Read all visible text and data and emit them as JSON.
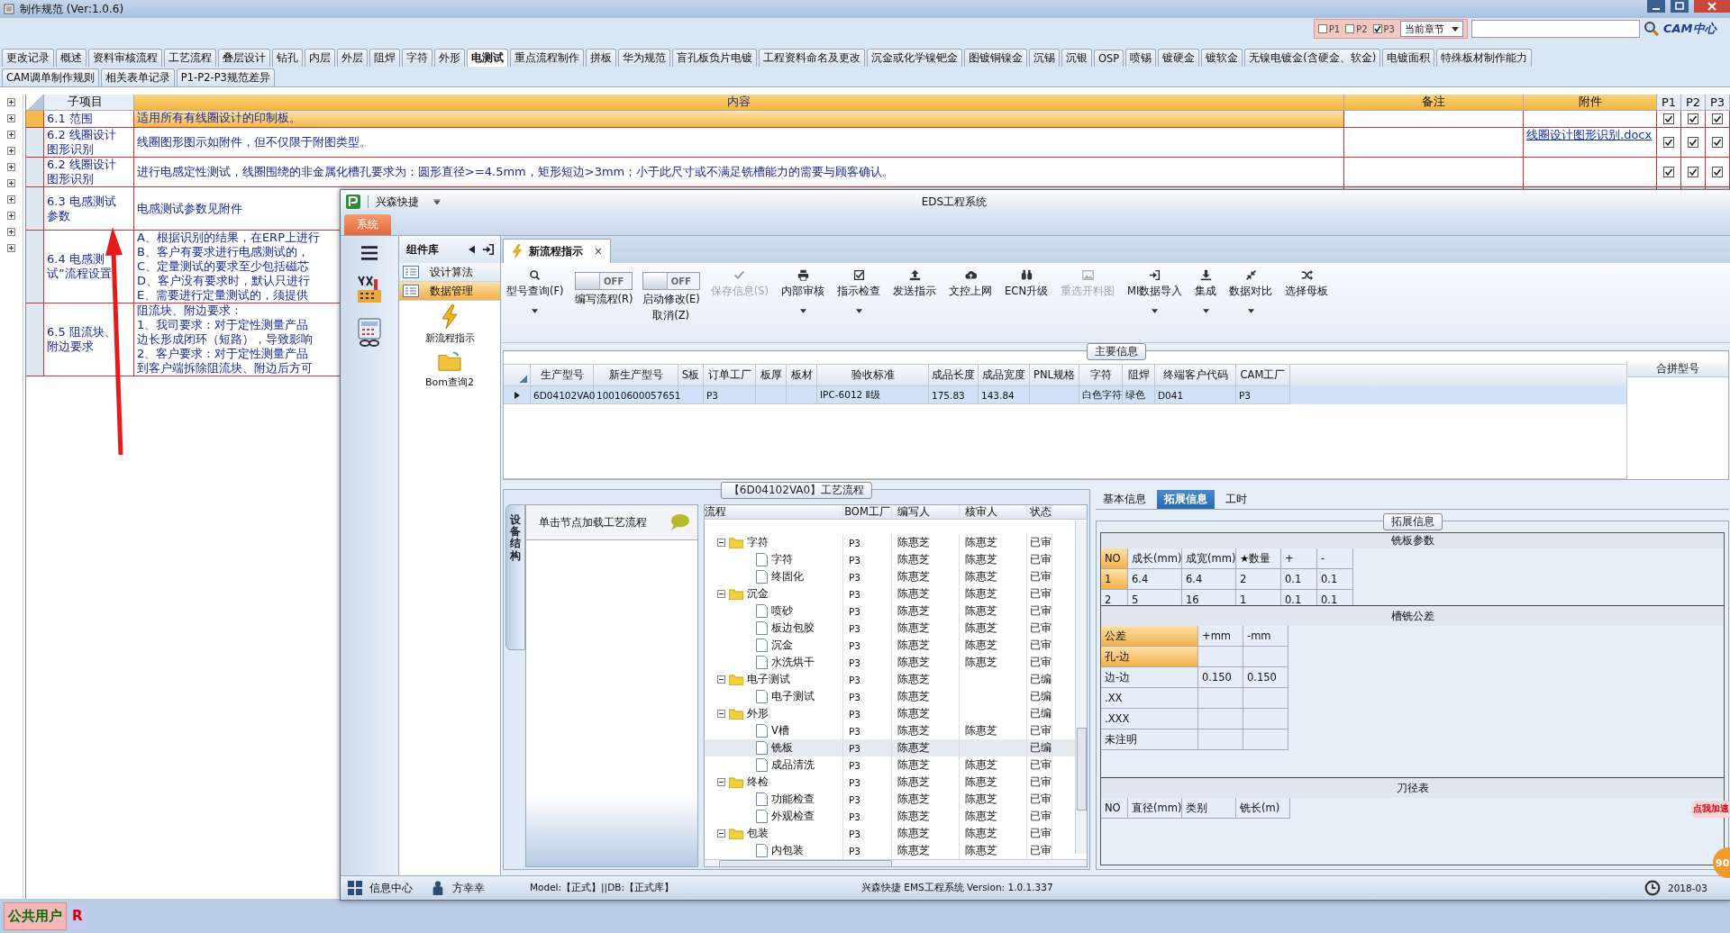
{
  "app": {
    "title": "制作规范 (Ver:1.0.6)"
  },
  "filter": {
    "checks": [
      {
        "label": "P1",
        "checked": false
      },
      {
        "label": "P2",
        "checked": false
      },
      {
        "label": "P3",
        "checked": true
      }
    ],
    "scope": "当前章节",
    "logo": "CAM中心"
  },
  "tabs_row1": [
    {
      "label": "更改记录",
      "selected": false
    },
    {
      "label": "概述",
      "selected": false
    },
    {
      "label": "资料审核流程",
      "selected": false
    },
    {
      "label": "工艺流程",
      "selected": false
    },
    {
      "label": "叠层设计",
      "selected": false
    },
    {
      "label": "钻孔",
      "selected": false
    },
    {
      "label": "内层",
      "selected": false
    },
    {
      "label": "外层",
      "selected": false
    },
    {
      "label": "阻焊",
      "selected": false
    },
    {
      "label": "字符",
      "selected": false
    },
    {
      "label": "外形",
      "selected": false
    },
    {
      "label": "电测试",
      "selected": true
    },
    {
      "label": "重点流程制作",
      "selected": false
    },
    {
      "label": "拼板",
      "selected": false
    },
    {
      "label": "华为规范",
      "selected": false
    },
    {
      "label": "盲孔板负片电镀",
      "selected": false
    },
    {
      "label": "工程资料命名及更改",
      "selected": false
    },
    {
      "label": "沉金或化学镍钯金",
      "selected": false
    },
    {
      "label": "图镀铜镍金",
      "selected": false
    },
    {
      "label": "沉锡",
      "selected": false
    },
    {
      "label": "沉银",
      "selected": false
    },
    {
      "label": "OSP",
      "selected": false
    },
    {
      "label": "喷锡",
      "selected": false
    },
    {
      "label": "镀硬金",
      "selected": false
    },
    {
      "label": "镀软金",
      "selected": false
    },
    {
      "label": "无镍电镀金(含硬金、软金)",
      "selected": false
    },
    {
      "label": "电镀面积",
      "selected": false
    },
    {
      "label": "特殊板材制作能力",
      "selected": false
    }
  ],
  "tabs_row2": [
    {
      "label": "CAM调单制作规则",
      "selected": false
    },
    {
      "label": "相关表单记录",
      "selected": false
    },
    {
      "label": "P1-P2-P3规范差异",
      "selected": false
    }
  ],
  "table": {
    "columns": [
      "子项目",
      "内容",
      "备注",
      "附件",
      "P1",
      "P2",
      "P3"
    ],
    "rows": [
      {
        "item": "6.1 范围",
        "content": [
          "适用所有有线圈设计的印制板。"
        ],
        "checks": [
          true,
          true,
          true
        ],
        "selected": true
      },
      {
        "item": "6.2 线圈设计图形识别",
        "content": [
          "线圈图形图示如附件，但不仅限于附图类型。"
        ],
        "attachment": "线圈设计图形识别.docx",
        "checks": [
          true,
          true,
          true
        ],
        "selected": false
      },
      {
        "item": "6.2 线圈设计图形识别",
        "content": [
          "进行电感定性测试，线圈围绕的非金属化槽孔要求为：圆形直径>=4.5mm，矩形短边>3mm；小于此尺寸或不满足铣槽能力的需要与顾客确认。"
        ],
        "checks": [
          true,
          true,
          true
        ],
        "selected": false
      },
      {
        "item": "6.3 电感测试参数",
        "content": [
          "电感测试参数见附件"
        ],
        "selected": false
      },
      {
        "item": "6.4 电感测试”流程设置",
        "content": [
          "A、根据识别的结果，在ERP上进行",
          "B、客户有要求进行电感测试的，",
          "C、定量测试的要求至少包括磁芯",
          "D、客户没有要求时，默认只进行",
          "E、需要进行定量测试的，须提供"
        ],
        "selected": false
      },
      {
        "item": "6.5 阻流块、附边要求",
        "content": [
          "阻流块、附边要求：",
          "1、我司要求：对于定性测量产品",
          "边长形成闭环（短路），导致影响",
          "2、客户要求：对于定性测量产品",
          "到客户端拆除阻流块、附边后方可"
        ],
        "selected": false
      }
    ]
  },
  "footer": {
    "user": "公共用户",
    "mark": "R"
  },
  "eds": {
    "brand": "兴森快捷",
    "title": "EDS工程系统",
    "menu_tab": "系统",
    "components": {
      "title": "组件库",
      "items": [
        {
          "label": "设计算法",
          "selected": false
        },
        {
          "label": "数据管理",
          "selected": true
        }
      ],
      "tools": [
        {
          "label": "新流程指示",
          "kind": "lightning"
        },
        {
          "label": "Bom查询2",
          "kind": "folder"
        }
      ]
    },
    "doc_tab": {
      "label": "新流程指示",
      "close": "×"
    },
    "toolbar": [
      {
        "kind": "button",
        "label": "型号查询(F)",
        "dropdown": true,
        "disabled": false
      },
      {
        "kind": "toggle",
        "label": "编写流程(R)",
        "state": "OFF",
        "on": false
      },
      {
        "kind": "toggle",
        "label": "启动修改(E)",
        "sub": "取消(Z)",
        "state": "OFF",
        "on": false
      },
      {
        "kind": "button",
        "label": "保存信息(S)",
        "dropdown": false,
        "disabled": true
      },
      {
        "kind": "button",
        "label": "内部审核",
        "dropdown": true,
        "disabled": false
      },
      {
        "kind": "button",
        "label": "指示检查",
        "dropdown": true,
        "disabled": false
      },
      {
        "kind": "button",
        "label": "发送指示",
        "dropdown": false,
        "disabled": false
      },
      {
        "kind": "button",
        "label": "文控上网",
        "dropdown": false,
        "disabled": false
      },
      {
        "kind": "button",
        "label": "ECN升级",
        "dropdown": false,
        "disabled": false
      },
      {
        "kind": "button",
        "label": "重选开料图",
        "dropdown": false,
        "disabled": true
      },
      {
        "kind": "button",
        "label": "MI数据导入",
        "dropdown": true,
        "disabled": false
      },
      {
        "kind": "button",
        "label": "集成",
        "dropdown": true,
        "disabled": false
      },
      {
        "kind": "button",
        "label": "数据对比",
        "dropdown": true,
        "disabled": false
      },
      {
        "kind": "button",
        "label": "选择母板",
        "dropdown": false,
        "disabled": false
      }
    ],
    "main_info": {
      "title": "主要信息",
      "columns": [
        "生产型号",
        "新生产型号",
        "S板",
        "订单工厂",
        "板厚",
        "板材",
        "验收标准",
        "成品长度",
        "成品宽度",
        "PNL规格",
        "字符",
        "阻焊",
        "终端客户代码",
        "CAM工厂"
      ],
      "rows": [
        {
          "cells": [
            "6D04102VA0",
            "10010600057651",
            "",
            "P3",
            "",
            "",
            "IPC-6012 Ⅱ级",
            "175.83",
            "143.84",
            "",
            "白色字符",
            "绿色",
            "D041",
            "P3"
          ],
          "selected": true
        }
      ],
      "side_column": "合拼型号"
    },
    "flow": {
      "title": "【6D04102VA0】工艺流程",
      "side_tab": "设备结构",
      "hint": "单击节点加载工艺流程",
      "columns": [
        "流程",
        "BOM工厂",
        "编写人",
        "核审人",
        "状态"
      ],
      "nodes": [
        {
          "name": "字符",
          "factory": "P3",
          "writer": "陈惠芝",
          "reviewer": "陈惠芝",
          "status": "已审",
          "expanded": true,
          "selected": false,
          "children": [
            {
              "name": "字符",
              "factory": "P3",
              "writer": "陈惠芝",
              "reviewer": "陈惠芝",
              "status": "已审",
              "selected": false
            },
            {
              "name": "终固化",
              "factory": "P3",
              "writer": "陈惠芝",
              "reviewer": "陈惠芝",
              "status": "已审",
              "selected": false
            }
          ]
        },
        {
          "name": "沉金",
          "factory": "P3",
          "writer": "陈惠芝",
          "reviewer": "陈惠芝",
          "status": "已审",
          "expanded": true,
          "selected": false,
          "children": [
            {
              "name": "喷砂",
              "factory": "P3",
              "writer": "陈惠芝",
              "reviewer": "陈惠芝",
              "status": "已审",
              "selected": false
            },
            {
              "name": "板边包胶",
              "factory": "P3",
              "writer": "陈惠芝",
              "reviewer": "陈惠芝",
              "status": "已审",
              "selected": false
            },
            {
              "name": "沉金",
              "factory": "P3",
              "writer": "陈惠芝",
              "reviewer": "陈惠芝",
              "status": "已审",
              "selected": false
            },
            {
              "name": "水洗烘干",
              "factory": "P3",
              "writer": "陈惠芝",
              "reviewer": "陈惠芝",
              "status": "已审",
              "selected": false
            }
          ]
        },
        {
          "name": "电子测试",
          "factory": "P3",
          "writer": "陈惠芝",
          "status": "已编",
          "expanded": true,
          "selected": false,
          "children": [
            {
              "name": "电子测试",
              "factory": "P3",
              "writer": "陈惠芝",
              "status": "已编",
              "selected": false
            }
          ]
        },
        {
          "name": "外形",
          "factory": "P3",
          "writer": "陈惠芝",
          "status": "已编",
          "expanded": true,
          "selected": false,
          "children": [
            {
              "name": "V槽",
              "factory": "P3",
              "writer": "陈惠芝",
              "reviewer": "陈惠芝",
              "status": "已审",
              "selected": false
            },
            {
              "name": "铣板",
              "factory": "P3",
              "writer": "陈惠芝",
              "status": "已编",
              "selected": true
            },
            {
              "name": "成品清洗",
              "factory": "P3",
              "writer": "陈惠芝",
              "reviewer": "陈惠芝",
              "status": "已审",
              "selected": false
            }
          ]
        },
        {
          "name": "终检",
          "factory": "P3",
          "writer": "陈惠芝",
          "reviewer": "陈惠芝",
          "status": "已审",
          "expanded": true,
          "selected": false,
          "children": [
            {
              "name": "功能检查",
              "factory": "P3",
              "writer": "陈惠芝",
              "reviewer": "陈惠芝",
              "status": "已审",
              "selected": false
            },
            {
              "name": "外观检查",
              "factory": "P3",
              "writer": "陈惠芝",
              "reviewer": "陈惠芝",
              "status": "已审",
              "selected": false
            }
          ]
        },
        {
          "name": "包装",
          "factory": "P3",
          "writer": "陈惠芝",
          "reviewer": "陈惠芝",
          "status": "已审",
          "expanded": true,
          "selected": false,
          "children": [
            {
              "name": "内包装",
              "factory": "P3",
              "writer": "陈惠芝",
              "reviewer": "陈惠芝",
              "status": "已审",
              "selected": false
            }
          ]
        }
      ]
    },
    "ext": {
      "tabs": [
        {
          "label": "基本信息",
          "selected": false
        },
        {
          "label": "拓展信息",
          "selected": true
        },
        {
          "label": "工时",
          "selected": false
        }
      ],
      "title": "拓展信息",
      "sections": [
        {
          "title": "铣板参数",
          "columns": [
            "NO",
            "成长(mm)",
            "成宽(mm)",
            "★数量",
            "+",
            "-"
          ],
          "rows": [
            {
              "cells": [
                "1",
                "6.4",
                "6.4",
                "2",
                "0.1",
                "0.1"
              ],
              "selected": true
            },
            {
              "cells": [
                "2",
                "5",
                "16",
                "1",
                "0.1",
                "0.1"
              ],
              "selected": false
            }
          ]
        },
        {
          "title": "槽铣公差",
          "columns": [
            "公差",
            "+mm",
            "-mm"
          ],
          "rows": [
            {
              "cells": [
                "孔-边",
                "",
                ""
              ],
              "selected": true
            },
            {
              "cells": [
                "边-边",
                "0.150",
                "0.150"
              ],
              "selected": false
            },
            {
              "cells": [
                ".XX",
                "",
                ""
              ],
              "selected": false
            },
            {
              "cells": [
                ".XXX",
                "",
                ""
              ],
              "selected": false
            },
            {
              "cells": [
                "未注明",
                "",
                ""
              ],
              "selected": false
            }
          ]
        },
        {
          "title": "刀径表",
          "columns": [
            "NO",
            "直径(mm)",
            "类别",
            "铣长(m)"
          ]
        }
      ]
    },
    "speed": {
      "label": "点我加速",
      "value": "90"
    },
    "status": {
      "items": [
        {
          "label": "信息中心"
        },
        {
          "label": "方幸幸"
        }
      ],
      "model": "Model:【正式】||DB:【正式库】",
      "version": "兴森快捷 EMS工程系统 Version: 1.0.1.337",
      "date": "2018-03"
    }
  }
}
